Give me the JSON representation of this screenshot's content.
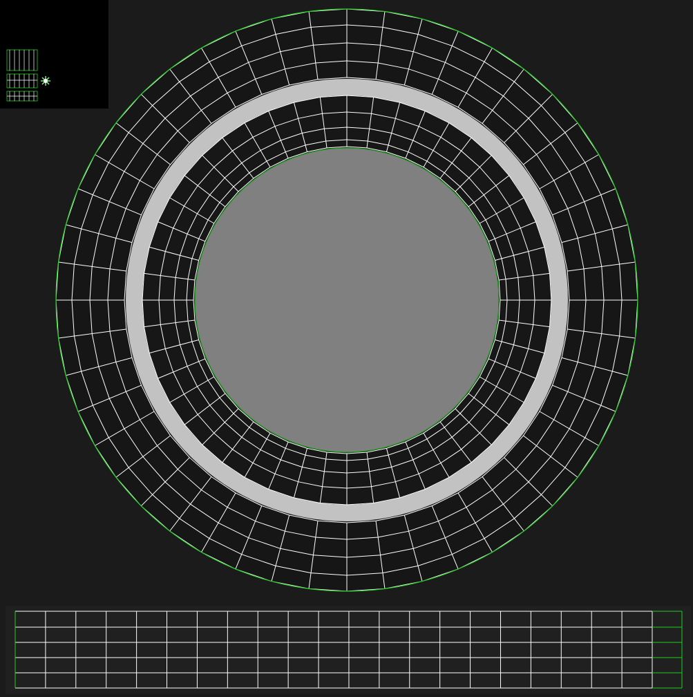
{
  "editor": {
    "mode": "uv-editor",
    "background_color": "#1b1b1b",
    "wire_color": "#ffffff",
    "seam_color": "#22cc22",
    "inner_disc_color": "#808080",
    "ring_band_color": "#c4c4c4",
    "dark_fill_color": "#141414"
  },
  "thumbnail": {
    "background_color": "#000000",
    "icon": "pivot-star-icon"
  },
  "tire_uv": {
    "radial_segments": 48,
    "outer_rings": 5,
    "inner_rings": 3,
    "strip_columns": 22,
    "strip_rows": 5
  }
}
